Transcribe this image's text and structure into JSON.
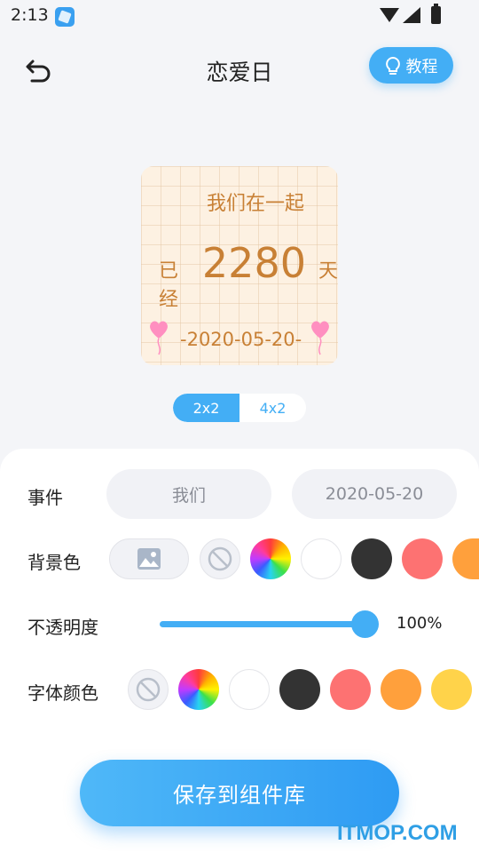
{
  "status_bar": {
    "time": "2:13"
  },
  "header": {
    "title": "恋爱日",
    "tutorial_label": "教程"
  },
  "widget": {
    "line1": "我们在一起",
    "prefix": "已经",
    "days": "2280",
    "suffix": "天",
    "date": "-2020-05-20-"
  },
  "size_options": [
    "2x2",
    "4x2"
  ],
  "size_selected": "2x2",
  "settings": {
    "event_label": "事件",
    "event_name": "我们",
    "event_date": "2020-05-20",
    "bg_color_label": "背景色",
    "opacity_label": "不透明度",
    "opacity_value": "100%",
    "opacity_fraction": 1.0,
    "font_color_label": "字体颜色"
  },
  "colors": {
    "accent": "#43aef5",
    "black": "#333333",
    "red": "#fd7272",
    "orange": "#ffa03c",
    "yellow": "#ffd34a",
    "white": "#ffffff"
  },
  "save_label": "保存到组件库",
  "watermark": "ITMOP.COM"
}
